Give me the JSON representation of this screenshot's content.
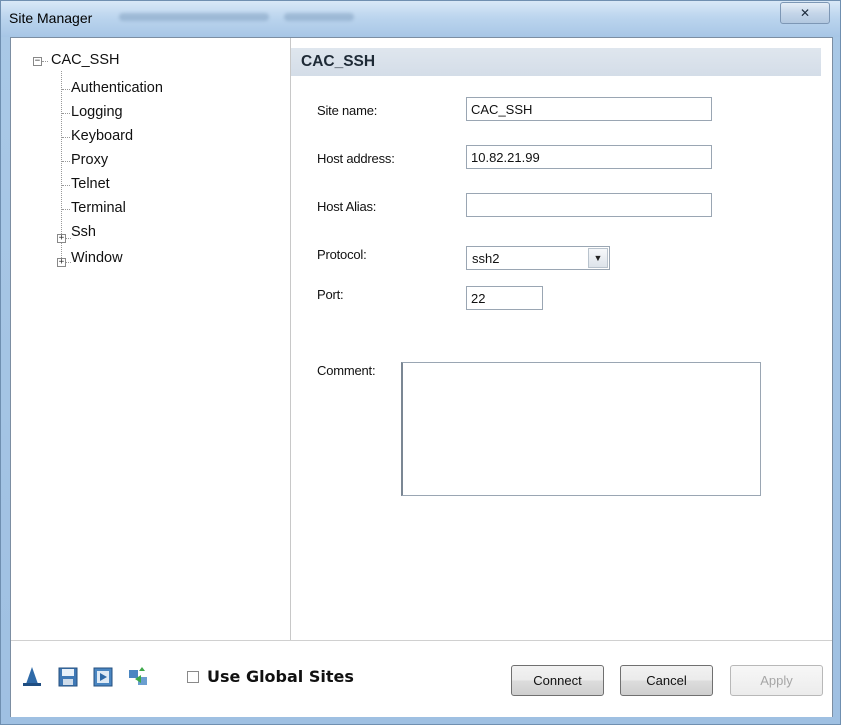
{
  "window": {
    "title": "Site Manager",
    "close_glyph": "✕"
  },
  "tree": {
    "root": "CAC_SSH",
    "root_expander": "−",
    "children": [
      "Authentication",
      "Logging",
      "Keyboard",
      "Proxy",
      "Telnet",
      "Terminal",
      "Ssh",
      "Window"
    ],
    "collapsed_expander": "+"
  },
  "panel": {
    "header": "CAC_SSH",
    "site_name_label": "Site name:",
    "site_name_value": "CAC_SSH",
    "host_address_label": "Host address:",
    "host_address_value": "10.82.21.99",
    "host_alias_label": "Host Alias:",
    "host_alias_value": "",
    "protocol_label": "Protocol:",
    "protocol_value": "ssh2",
    "protocol_arrow": "▼",
    "port_label": "Port:",
    "port_value": "22",
    "comment_label": "Comment:",
    "comment_value": ""
  },
  "bottom": {
    "icons": [
      "wizard-hat-icon",
      "save-icon",
      "import-icon",
      "transfer-icon"
    ],
    "use_global_label": "Use Global Sites",
    "use_global_checked": false,
    "connect_label": "Connect",
    "cancel_label": "Cancel",
    "apply_label": "Apply",
    "apply_enabled": false
  },
  "colors": {
    "title_gradient": "#bcd5ee",
    "header_bg": "#d4dde8"
  }
}
